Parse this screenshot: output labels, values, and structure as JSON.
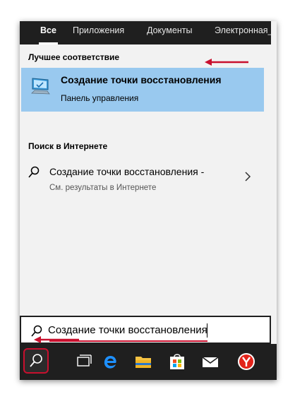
{
  "tabs": [
    {
      "label": "Все",
      "active": true
    },
    {
      "label": "Приложения",
      "active": false
    },
    {
      "label": "Документы",
      "active": false
    },
    {
      "label": "Электронная_",
      "active": false
    }
  ],
  "best_match": {
    "header": "Лучшее соответствие",
    "title": "Создание точки восстановления",
    "subtitle": "Панель управления",
    "icon": "system-restore-pc-icon"
  },
  "web_search": {
    "header": "Поиск в Интернете",
    "title": "Создание точки восстановления -",
    "subtitle": "См. результаты в Интернете"
  },
  "search": {
    "value": "Создание точки восстановления"
  },
  "taskbar": {
    "items": [
      "search-icon",
      "task-view-icon",
      "edge-icon",
      "file-explorer-icon",
      "store-icon",
      "mail-icon",
      "yandex-browser-icon"
    ]
  },
  "colors": {
    "accent": "#99c9ef",
    "annotation": "#c8102e",
    "dark": "#1f1f1f"
  }
}
